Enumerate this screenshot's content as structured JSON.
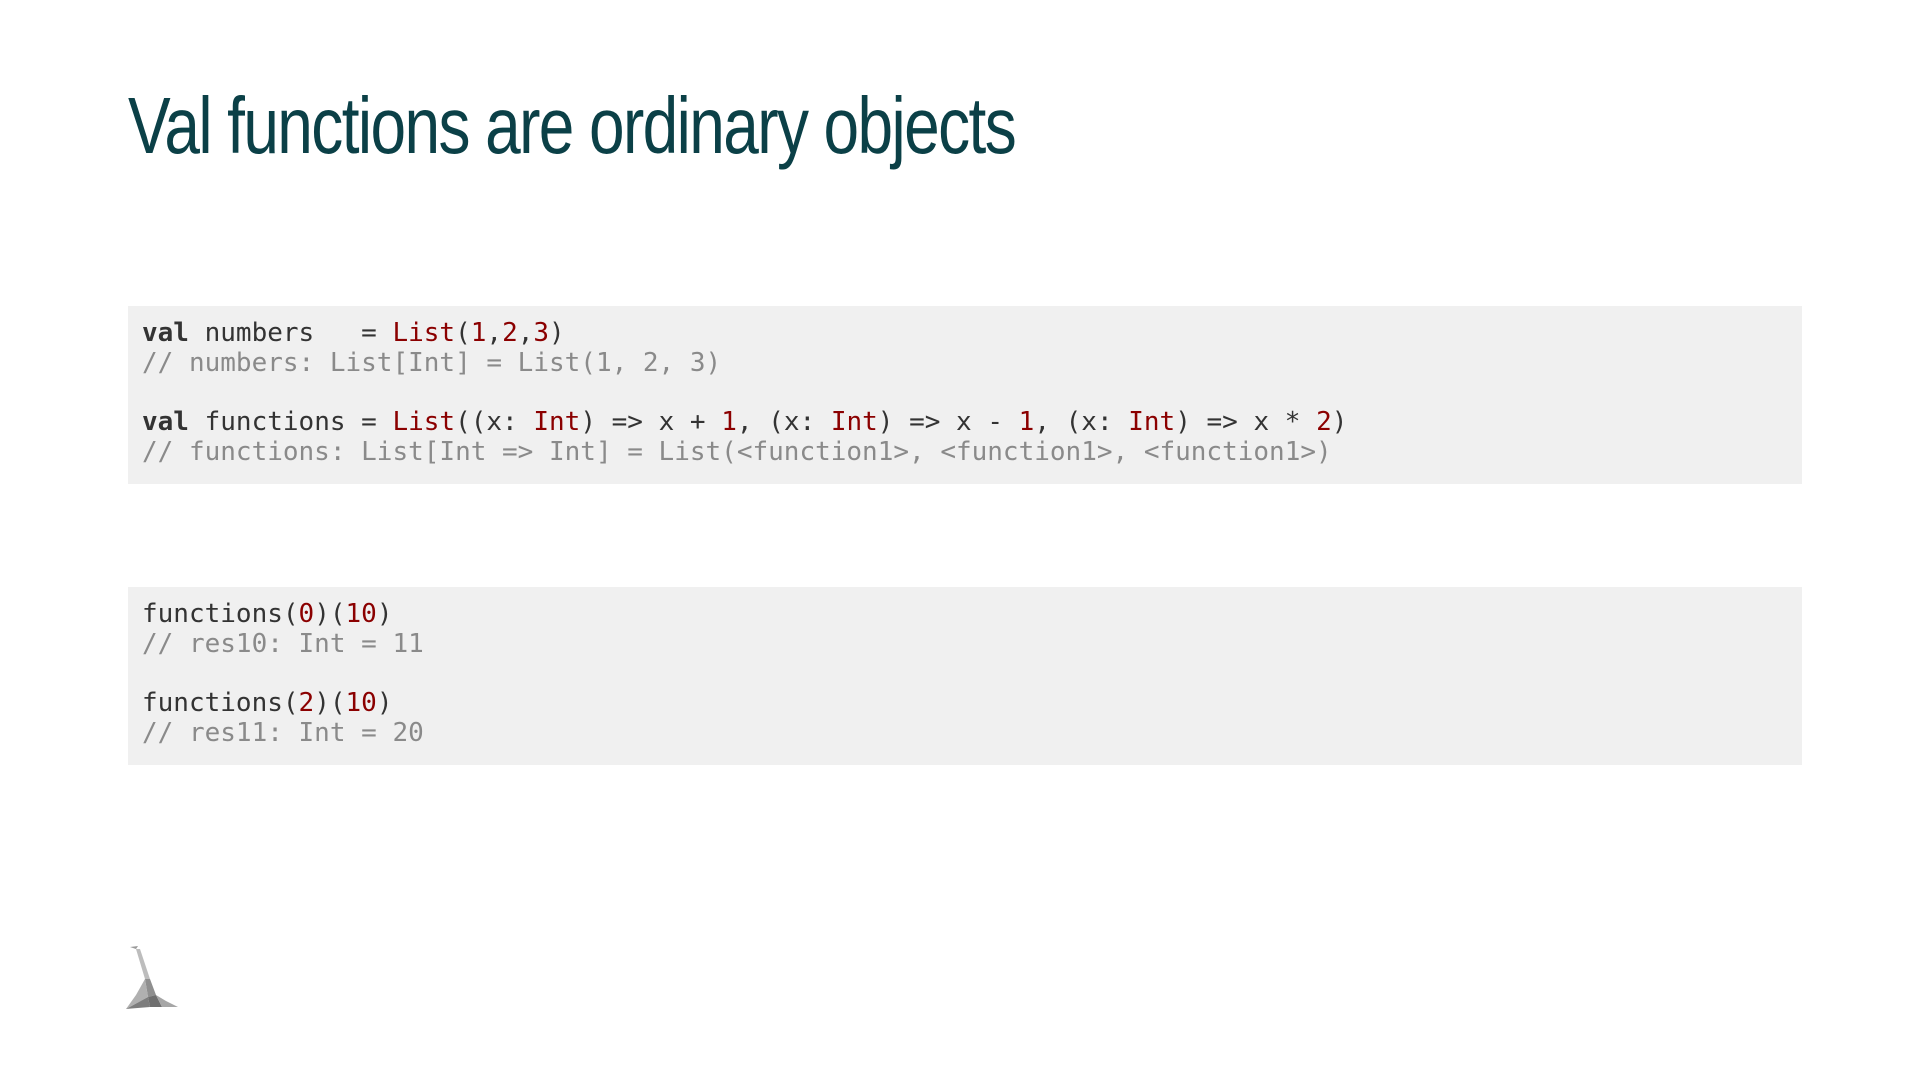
{
  "slide": {
    "title": "Val functions are ordinary objects"
  },
  "block1": {
    "line1": {
      "kw": "val",
      "name": " numbers   = ",
      "type": "List",
      "p1": "(",
      "n1": "1",
      "c1": ",",
      "n2": "2",
      "c2": ",",
      "n3": "3",
      "p2": ")"
    },
    "comment1": "// numbers: List[Int] = List(1, 2, 3)",
    "line2": {
      "kw": "val",
      "name": " functions = ",
      "type_list": "List",
      "a1": "((x: ",
      "t1": "Int",
      "a2": ") => x + ",
      "n1": "1",
      "a3": ", (x: ",
      "t2": "Int",
      "a4": ") => x - ",
      "n2": "1",
      "a5": ", (x: ",
      "t3": "Int",
      "a6": ") => x * ",
      "n3": "2",
      "a7": ")"
    },
    "comment2": "// functions: List[Int => Int] = List(<function1>, <function1>, <function1>)"
  },
  "block2": {
    "call1": {
      "fn": "functions(",
      "idx": "0",
      "mid": ")(",
      "arg": "10",
      "end": ")"
    },
    "comment1": "// res10: Int = 11",
    "call2": {
      "fn": "functions(",
      "idx": "2",
      "mid": ")(",
      "arg": "10",
      "end": ")"
    },
    "comment2": "// res11: Int = 20"
  },
  "logo": {
    "icon": "lambda-logo-icon",
    "colors": [
      "#bdbdbd",
      "#8f8f8f",
      "#6f6f6f"
    ]
  }
}
